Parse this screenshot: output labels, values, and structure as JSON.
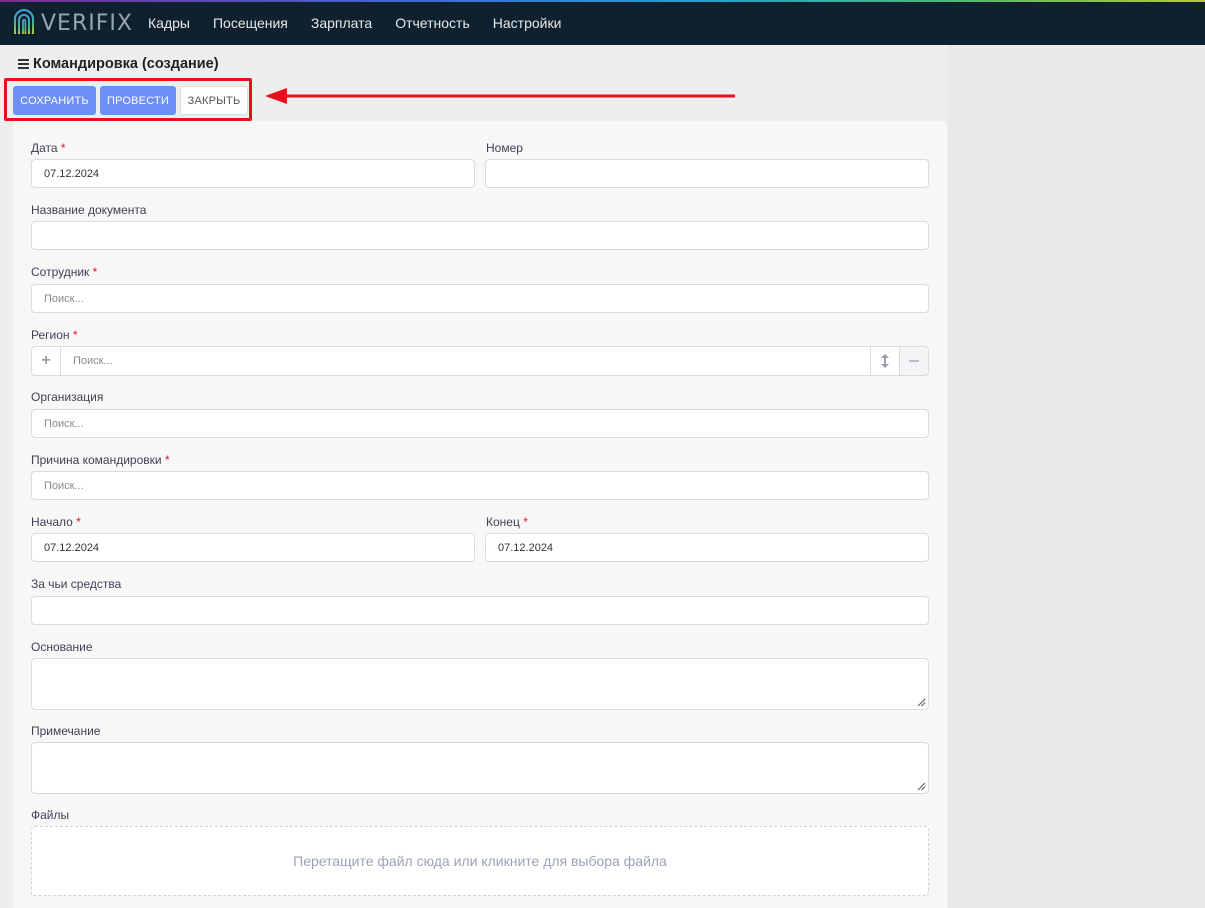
{
  "app": {
    "logo_text": "VERIFIX"
  },
  "nav": [
    {
      "label": "Кадры"
    },
    {
      "label": "Посещения"
    },
    {
      "label": "Зарплата"
    },
    {
      "label": "Отчетность"
    },
    {
      "label": "Настройки"
    }
  ],
  "page": {
    "title": "Командировка (создание)"
  },
  "toolbar": {
    "save": "СОХРАНИТЬ",
    "post": "ПРОВЕСТИ",
    "close": "ЗАКРЫТЬ"
  },
  "form": {
    "date": {
      "label": "Дата",
      "value": "07.12.2024",
      "required": "*"
    },
    "number": {
      "label": "Номер",
      "value": ""
    },
    "doc_name": {
      "label": "Название документа",
      "value": ""
    },
    "employee": {
      "label": "Сотрудник",
      "placeholder": "Поиск...",
      "required": "*"
    },
    "region": {
      "label": "Регион",
      "placeholder": "Поиск...",
      "required": "*"
    },
    "organization": {
      "label": "Организация",
      "placeholder": "Поиск..."
    },
    "reason": {
      "label": "Причина командировки",
      "placeholder": "Поиск...",
      "required": "*"
    },
    "start": {
      "label": "Начало",
      "value": "07.12.2024",
      "required": "*"
    },
    "end": {
      "label": "Конец",
      "value": "07.12.2024",
      "required": "*"
    },
    "funds": {
      "label": "За чьи средства",
      "value": ""
    },
    "basis": {
      "label": "Основание",
      "value": ""
    },
    "note": {
      "label": "Примечание",
      "value": ""
    },
    "files": {
      "label": "Файлы",
      "dropzone": "Перетащите файл сюда или кликните для выбора файла"
    }
  },
  "colors": {
    "primary": "#6c8ef7",
    "nav_bg": "#0f212e",
    "highlight": "#e8101c",
    "required": "#e8101c"
  },
  "icons": [
    "menu-icon",
    "plus-icon",
    "sort-icon",
    "minus-icon",
    "resize-handle-icon",
    "fingerprint-logo-icon"
  ]
}
